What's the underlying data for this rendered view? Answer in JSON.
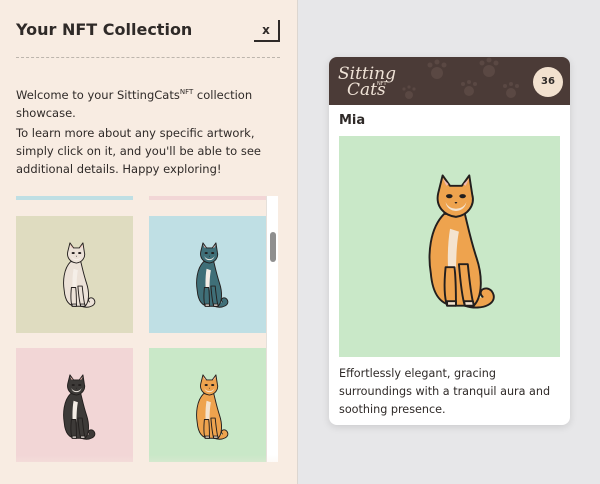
{
  "panel": {
    "title": "Your NFT Collection",
    "close_label": "x",
    "intro_prefix": "Welcome to your SittingCats",
    "intro_sup": "NFT",
    "intro_suffix": " collection showcase.",
    "intro_line2": "To learn more about any specific artwork, simply click on it, and you'll be able to see additional details. Happy exploring!"
  },
  "collection": {
    "tiles": [
      {
        "background": "#dfdcc0",
        "fur": "#ece2d8",
        "accent": "#f5efe8",
        "head_patch": "#ece2d8"
      },
      {
        "background": "#bfdfe4",
        "fur": "#3f6f78",
        "accent": "#f4ede6",
        "head_patch": "#3f6f78"
      },
      {
        "background": "#f2d6d6",
        "fur": "#3d3a38",
        "accent": "#f4ede6",
        "head_patch": "#3d3a38"
      },
      {
        "background": "#c9e8c8",
        "fur": "#eea34e",
        "accent": "#f4e3cf",
        "head_patch": "#eea34e"
      }
    ],
    "top_strip_colors": [
      "#bfdfe4",
      "#f2d6d6"
    ]
  },
  "card": {
    "logo_line1": "Sitting",
    "logo_line2": "Cats",
    "logo_nft": "NFT",
    "number": "36",
    "name": "Mia",
    "description": "Effortlessly elegant, gracing surroundings with a tranquil aura and soothing presence.",
    "art_background": "#c9e8c8",
    "header_color": "#4b3b37"
  }
}
